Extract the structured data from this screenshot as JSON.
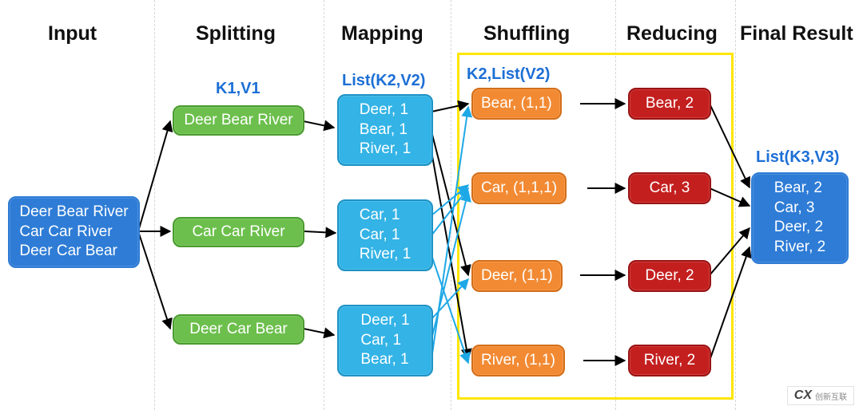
{
  "headers": {
    "input": "Input",
    "splitting": "Splitting",
    "mapping": "Mapping",
    "shuffling": "Shuffling",
    "reducing": "Reducing",
    "final": "Final Result"
  },
  "subheaders": {
    "k1v1": "K1,V1",
    "listk2v2": "List(K2,V2)",
    "k2listv2": "K2,List(V2)",
    "listk3v3": "List(K3,V3)"
  },
  "input_block": "Deer Bear River\nCar Car River\nDeer Car Bear",
  "splits": [
    "Deer Bear River",
    "Car Car River",
    "Deer Car Bear"
  ],
  "maps": [
    "Deer, 1\nBear, 1\nRiver, 1",
    "Car, 1\nCar, 1\nRiver, 1",
    "Deer, 1\nCar, 1\nBear, 1"
  ],
  "shuffles": [
    "Bear, (1,1)",
    "Car, (1,1,1)",
    "Deer, (1,1)",
    "River, (1,1)"
  ],
  "reduces": [
    "Bear, 2",
    "Car, 3",
    "Deer, 2",
    "River, 2"
  ],
  "final_block": "Bear, 2\nCar, 3\nDeer, 2\nRiver, 2",
  "watermark": {
    "brand": "创新互联"
  }
}
